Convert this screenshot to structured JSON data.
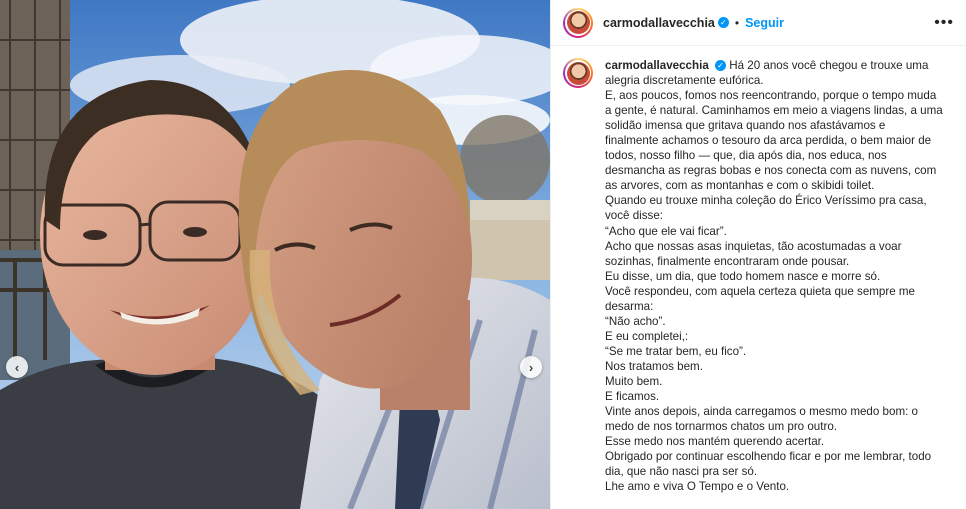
{
  "header": {
    "username": "carmodallavecchia",
    "separator": "•",
    "follow_label": "Seguir",
    "more_label": "•••"
  },
  "media": {
    "prev_label": "‹",
    "next_label": "›"
  },
  "caption": {
    "username": "carmodallavecchia",
    "first_line": "Há 20 anos você chegou e trouxe uma",
    "lines": [
      "alegria discretamente eufórica.",
      "E, aos poucos, fomos nos reencontrando, porque o tempo muda",
      "a gente, é natural. Caminhamos em meio a viagens lindas, a uma",
      "solidão imensa que gritava quando nos afastávamos e",
      "finalmente achamos o tesouro da arca perdida, o bem maior de",
      "todos, nosso filho — que, dia após dia, nos educa, nos",
      "desmancha as regras bobas e nos conecta com as nuvens, com",
      "as arvores, com as montanhas e com o skibidi toilet.",
      "Quando eu trouxe minha coleção do Érico Veríssimo pra casa,",
      "você disse:",
      "“Acho que ele vai ficar”.",
      "Acho que nossas asas inquietas, tão acostumadas a voar",
      "sozinhas, finalmente encontraram onde pousar.",
      "Eu disse, um dia, que todo homem nasce e morre só.",
      "Você respondeu, com aquela certeza quieta que sempre me",
      "desarma:",
      "“Não acho”.",
      "E eu completei,:",
      "“Se me tratar bem, eu fico”.",
      "Nos tratamos bem.",
      "Muito bem.",
      "E ficamos.",
      "Vinte anos depois, ainda carregamos o mesmo medo bom: o",
      "medo de nos tornarmos chatos um pro outro.",
      "Esse medo nos mantém querendo acertar.",
      "Obrigado por continuar escolhendo ficar e por me lembrar, todo",
      "dia, que não nasci pra ser só.",
      "Lhe amo e viva O Tempo e o Vento."
    ]
  },
  "colors": {
    "link": "#0095f6",
    "text": "#262626",
    "border": "#efefef"
  }
}
